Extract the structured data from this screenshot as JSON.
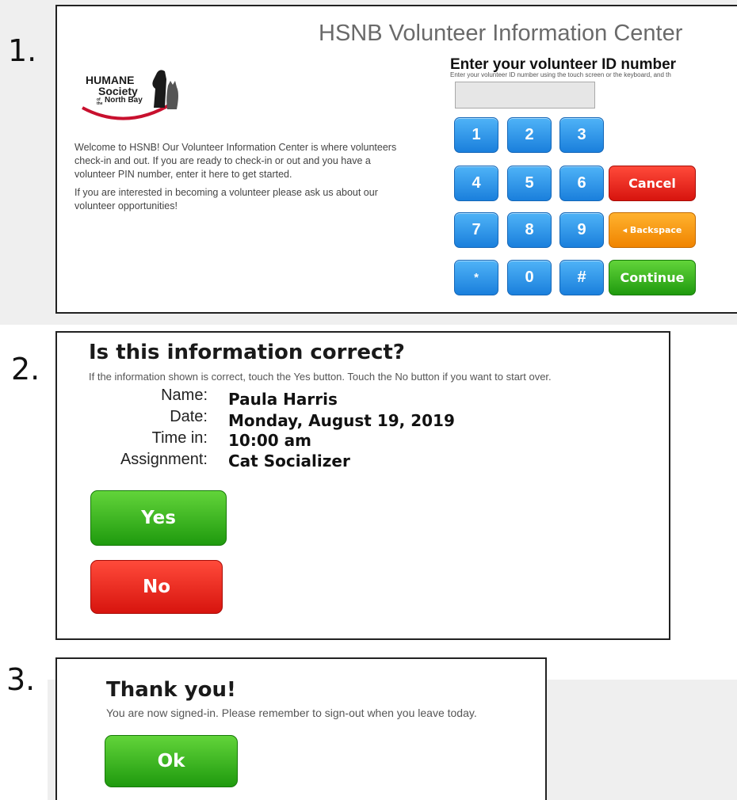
{
  "steps": [
    "1.",
    "2.",
    "3."
  ],
  "screen1": {
    "title": "HSNB Volunteer Information Center",
    "logo": {
      "line1": "HUMANE",
      "line2": "Society",
      "line3": "North Bay",
      "of": "of the"
    },
    "welcome": [
      "Welcome to HSNB! Our Volunteer Information Center is where volunteers check-in and out. If you are ready to check-in or out and you have a volunteer PIN number, enter it here to get started.",
      "If you are interested in becoming a volunteer please ask us about our volunteer opportunities!"
    ],
    "prompt_heading": "Enter your volunteer ID number",
    "prompt_sub": "Enter your volunteer ID number using the touch screen or the keyboard, and th",
    "id_input": {
      "value": "",
      "placeholder": ""
    },
    "keypad": [
      "1",
      "2",
      "3",
      "4",
      "5",
      "6",
      "7",
      "8",
      "9",
      "*",
      "0",
      "#"
    ],
    "cancel_label": "Cancel",
    "backspace_label": "◂ Backspace",
    "continue_label": "Continue"
  },
  "screen2": {
    "title": "Is this information correct?",
    "subtitle": "If the information shown is correct, touch the Yes button. Touch the No button if you want to start over.",
    "fields": [
      {
        "label": "Name:",
        "value": "Paula Harris"
      },
      {
        "label": "Date:",
        "value": "Monday, August 19, 2019"
      },
      {
        "label": "Time in:",
        "value": "10:00 am"
      },
      {
        "label": "Assignment:",
        "value": "Cat Socializer"
      }
    ],
    "yes_label": "Yes",
    "no_label": "No"
  },
  "screen3": {
    "title": "Thank you!",
    "subtitle": "You are now signed-in. Please remember to sign-out when you leave today.",
    "ok_label": "Ok"
  },
  "colors": {
    "key_blue": "#2a90e8",
    "cancel_red": "#e21b12",
    "backspace_orange": "#f59500",
    "continue_green": "#2aa815"
  }
}
